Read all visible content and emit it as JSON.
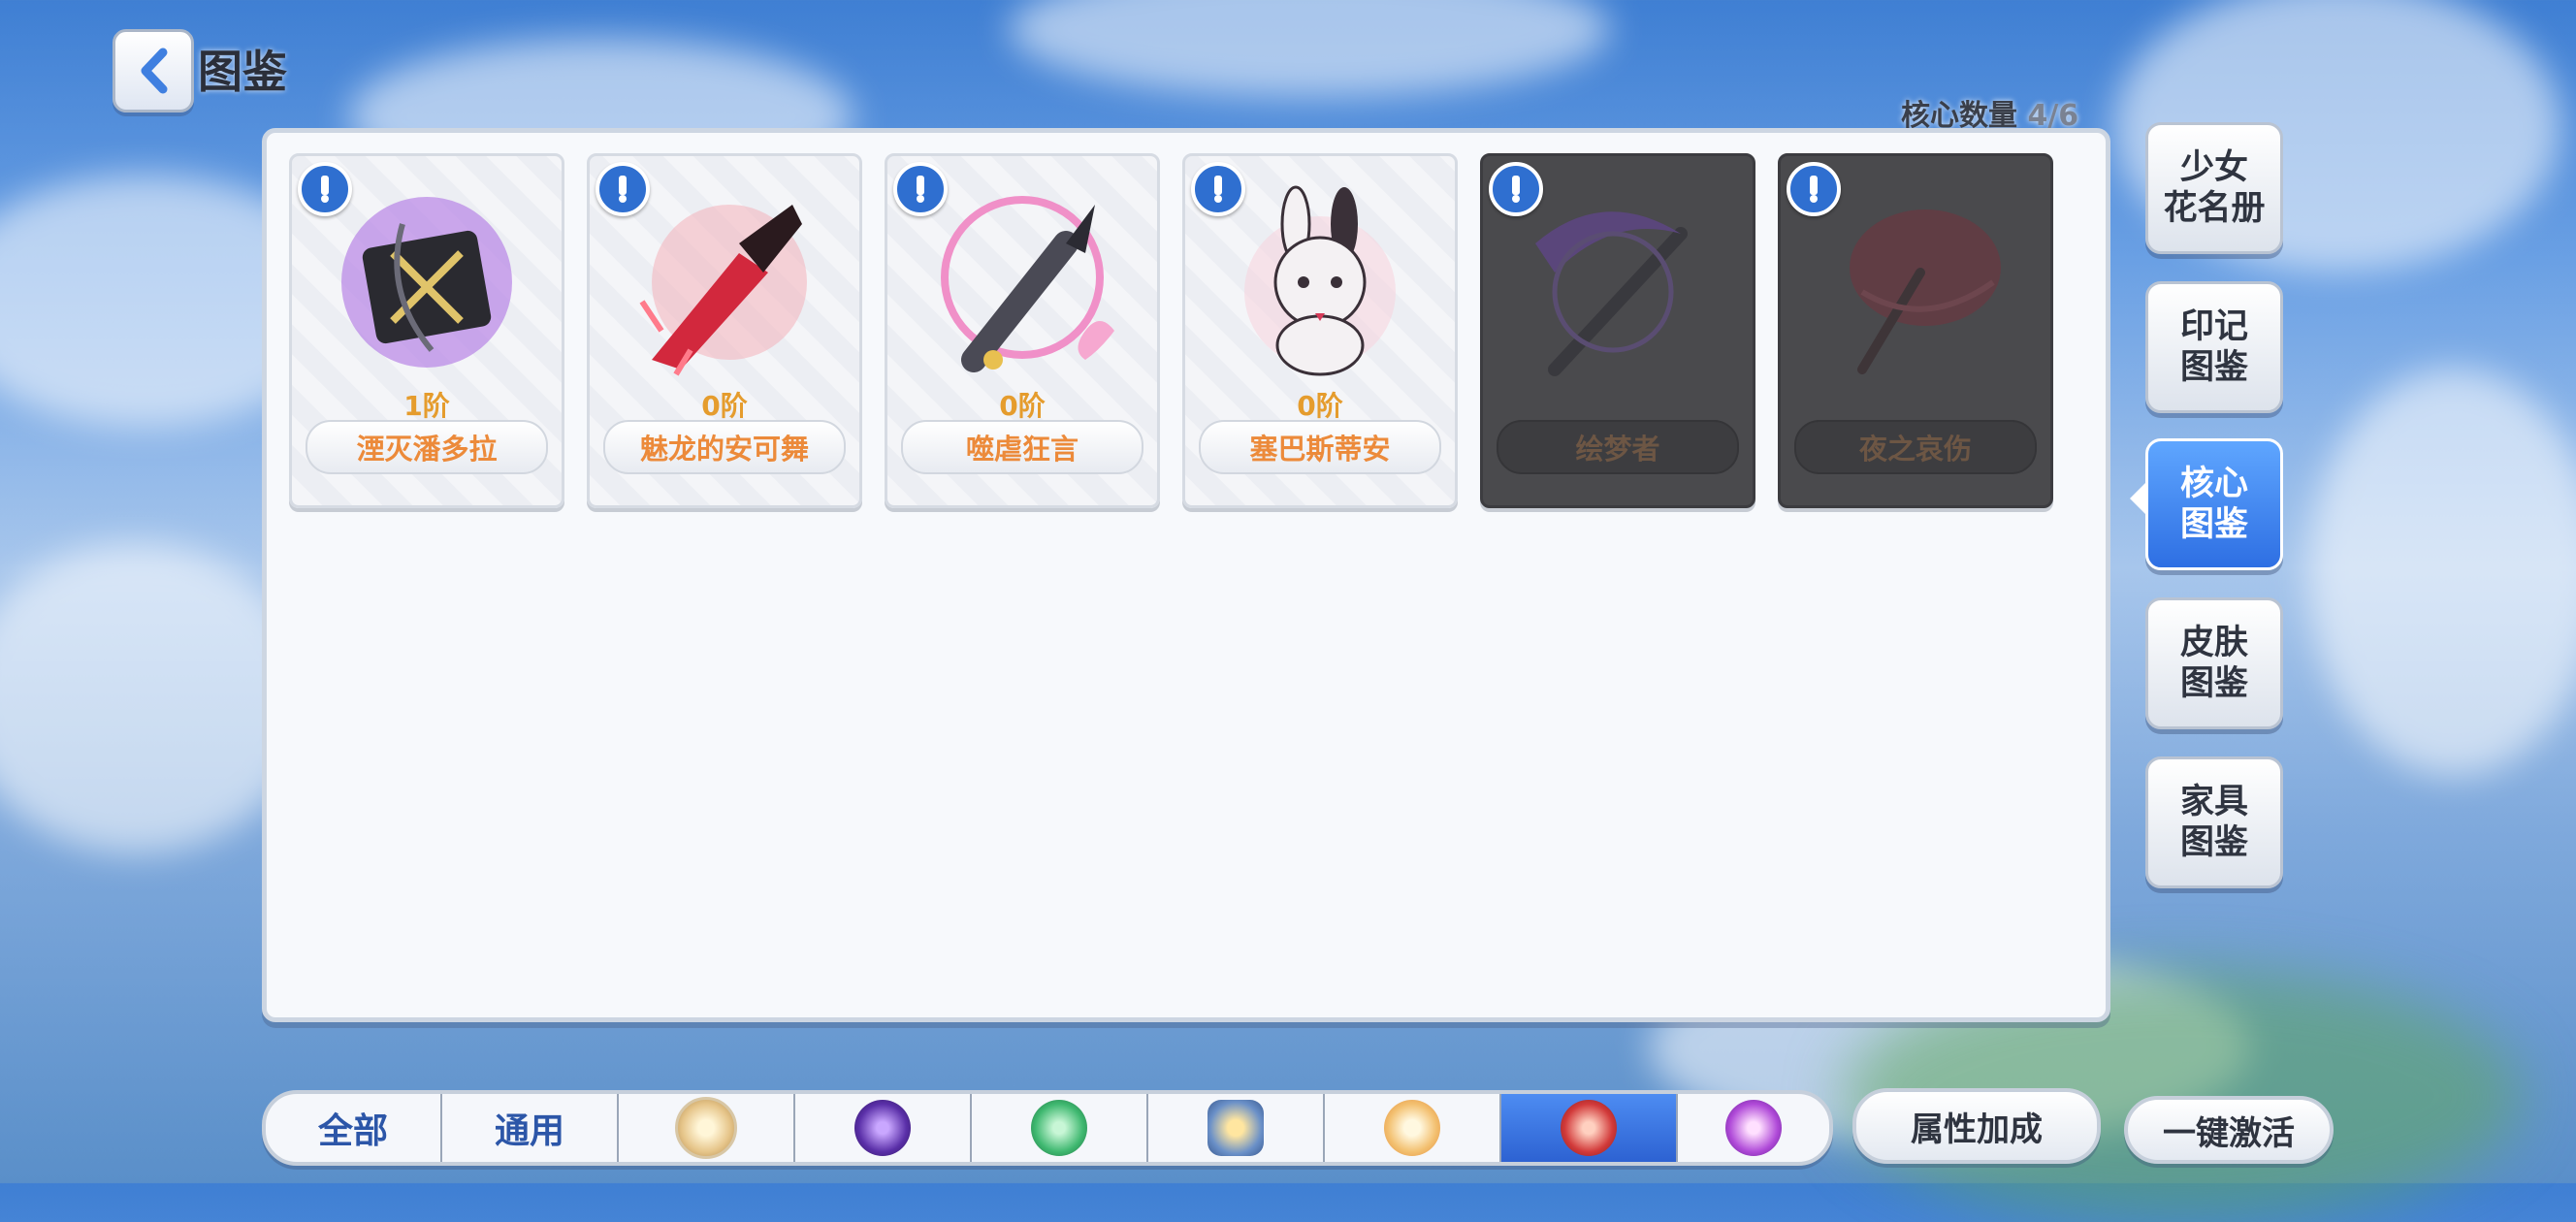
{
  "header": {
    "title": "图鉴"
  },
  "core_count": {
    "label": "核心数量",
    "value": "4/6"
  },
  "cards": [
    {
      "rank": "1阶",
      "name": "湮灭潘多拉",
      "locked": false
    },
    {
      "rank": "0阶",
      "name": "魅龙的安可舞",
      "locked": false
    },
    {
      "rank": "0阶",
      "name": "噬虐狂言",
      "locked": false
    },
    {
      "rank": "0阶",
      "name": "塞巴斯蒂安",
      "locked": false
    },
    {
      "rank": "",
      "name": "绘梦者",
      "locked": true
    },
    {
      "rank": "",
      "name": "夜之哀伤",
      "locked": true
    }
  ],
  "side_tabs": [
    {
      "line1": "少女",
      "line2": "花名册"
    },
    {
      "line1": "印记",
      "line2": "图鉴"
    },
    {
      "line1": "核心",
      "line2": "图鉴",
      "active": true
    },
    {
      "line1": "皮肤",
      "line2": "图鉴"
    },
    {
      "line1": "家具",
      "line2": "图鉴"
    }
  ],
  "filters": {
    "all": "全部",
    "general": "通用",
    "elements": [
      "light-element-icon",
      "dark-element-icon",
      "wind-element-icon",
      "earth-element-icon",
      "sun-element-icon",
      "fire-element-icon",
      "void-element-icon"
    ],
    "active_index": 7
  },
  "buttons": {
    "attribute_bonus": "属性加成",
    "activate_all": "一键激活"
  },
  "colors": {
    "accent_blue": "#2e6fe3",
    "name_orange": "#ec8a3a",
    "rank_gold": "#e59c2d"
  }
}
